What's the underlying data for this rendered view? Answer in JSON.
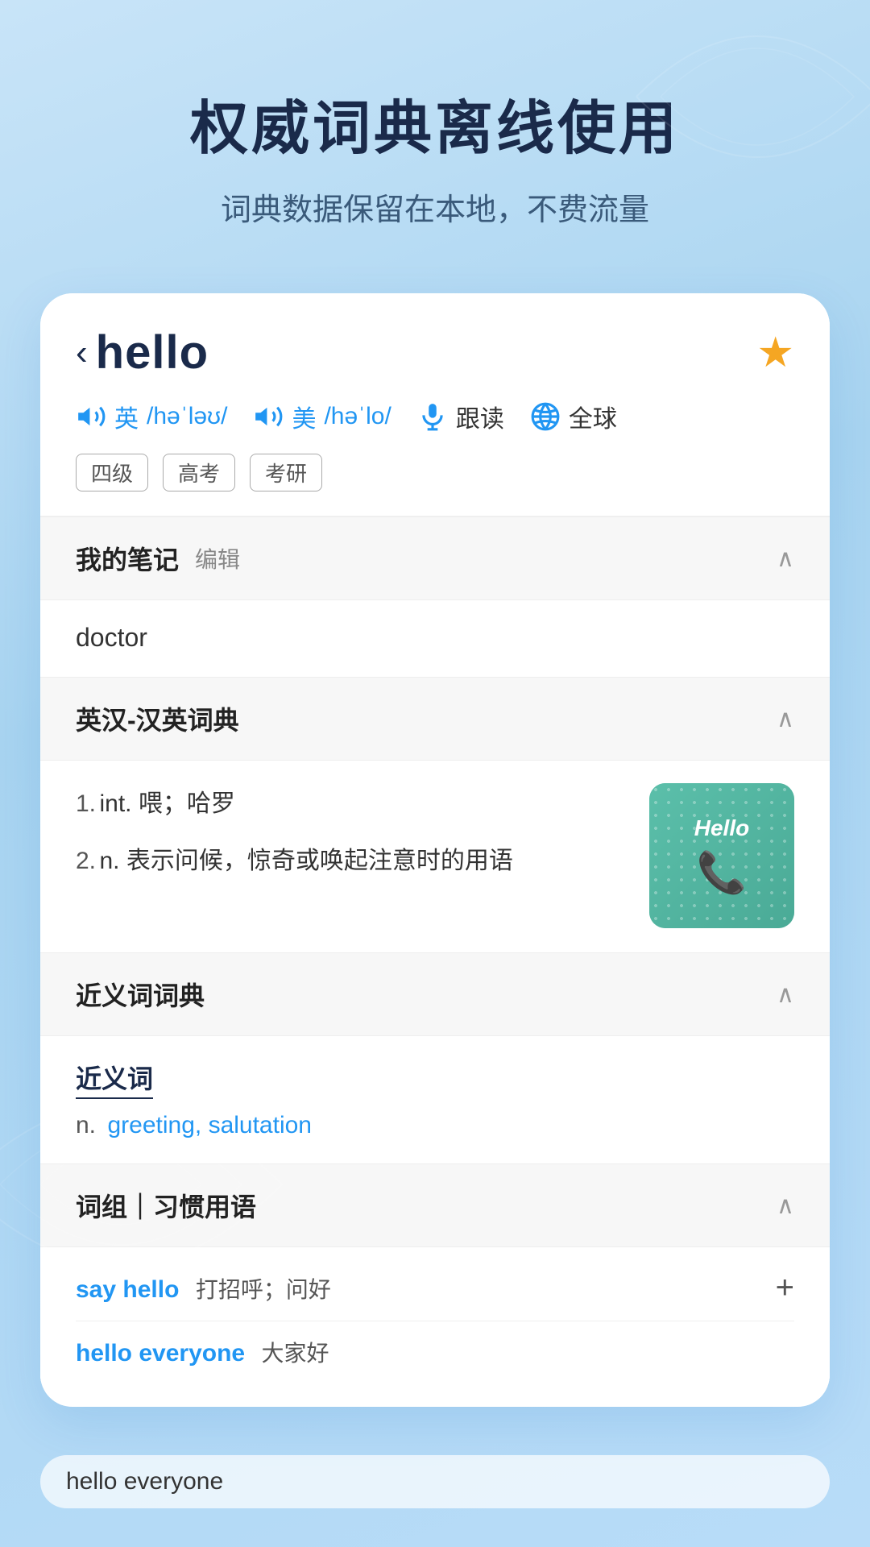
{
  "hero": {
    "title": "权威词典离线使用",
    "subtitle": "词典数据保留在本地，不费流量"
  },
  "card": {
    "back_label": "‹",
    "word": "hello",
    "star_icon": "★",
    "phonetics": {
      "uk_label": "英",
      "uk_phonetic": "/həˈləʊ/",
      "us_label": "美",
      "us_phonetic": "/həˈlo/",
      "follow_label": "跟读",
      "global_label": "全球"
    },
    "tags": [
      "四级",
      "高考",
      "考研"
    ]
  },
  "notes_section": {
    "title": "我的笔记",
    "edit_label": "编辑",
    "content": "doctor",
    "chevron": "∧"
  },
  "dict_section": {
    "title": "英汉-汉英词典",
    "chevron": "∧",
    "definitions": [
      {
        "num": "1.",
        "text": "int. 喂；哈罗"
      },
      {
        "num": "2.",
        "text": "n. 表示问候，惊奇或唤起注意时的用语"
      }
    ],
    "image_text": "Hello"
  },
  "synonym_section": {
    "title": "近义词词典",
    "chevron": "∧",
    "synonym_label": "近义词",
    "pos": "n.",
    "words": "greeting, salutation"
  },
  "phrases_section": {
    "title": "词组｜习惯用语",
    "chevron": "∧",
    "phrases": [
      {
        "en": "say hello",
        "cn": "打招呼；问好",
        "has_plus": true
      },
      {
        "en": "hello everyone",
        "cn": "大家好",
        "has_plus": false
      }
    ]
  },
  "bottom": {
    "input_text": "hello everyone"
  }
}
